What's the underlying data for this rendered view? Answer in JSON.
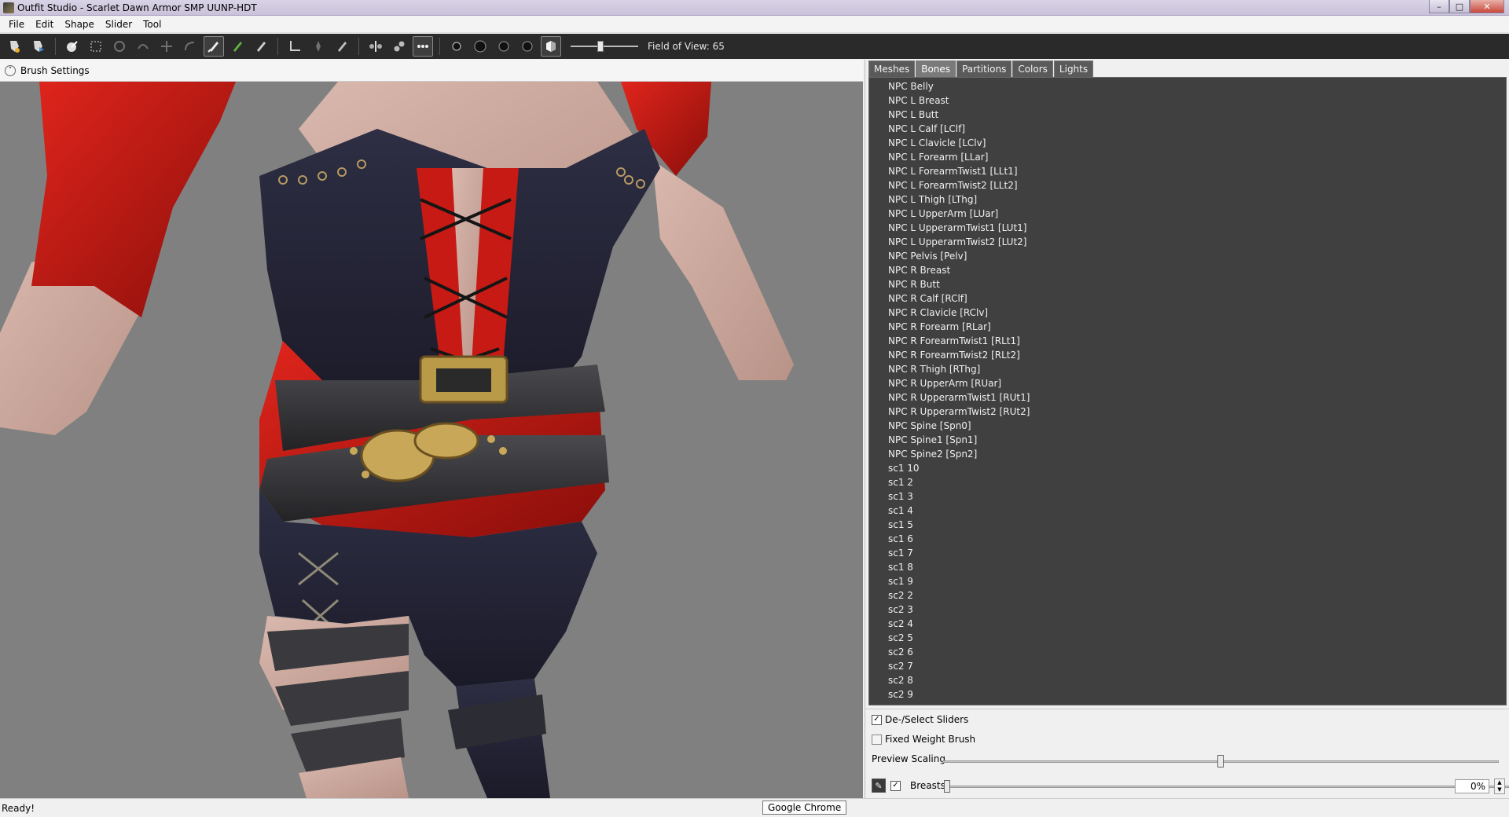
{
  "window": {
    "title": "Outfit Studio - Scarlet Dawn Armor SMP UUNP-HDT",
    "minimize": "–",
    "maximize": "□",
    "close": "✕"
  },
  "menu": [
    "File",
    "Edit",
    "Shape",
    "Slider",
    "Tool"
  ],
  "toolbar": {
    "field_of_view_label": "Field of View: 65",
    "field_of_view_value": 65
  },
  "brush_settings": {
    "toggle": "˅",
    "label": "Brush Settings"
  },
  "tabs": [
    "Meshes",
    "Bones",
    "Partitions",
    "Colors",
    "Lights"
  ],
  "active_tab": "Bones",
  "bones": [
    "NPC Belly",
    "NPC L Breast",
    "NPC L Butt",
    "NPC L Calf [LClf]",
    "NPC L Clavicle [LClv]",
    "NPC L Forearm [LLar]",
    "NPC L ForearmTwist1 [LLt1]",
    "NPC L ForearmTwist2 [LLt2]",
    "NPC L Thigh [LThg]",
    "NPC L UpperArm [LUar]",
    "NPC L UpperarmTwist1 [LUt1]",
    "NPC L UpperarmTwist2 [LUt2]",
    "NPC Pelvis [Pelv]",
    "NPC R Breast",
    "NPC R Butt",
    "NPC R Calf [RClf]",
    "NPC R Clavicle [RClv]",
    "NPC R Forearm [RLar]",
    "NPC R ForearmTwist1 [RLt1]",
    "NPC R ForearmTwist2 [RLt2]",
    "NPC R Thigh [RThg]",
    "NPC R UpperArm [RUar]",
    "NPC R UpperarmTwist1 [RUt1]",
    "NPC R UpperarmTwist2 [RUt2]",
    "NPC Spine [Spn0]",
    "NPC Spine1 [Spn1]",
    "NPC Spine2 [Spn2]",
    "sc1 10",
    "sc1 2",
    "sc1 3",
    "sc1 4",
    "sc1 5",
    "sc1 6",
    "sc1 7",
    "sc1 8",
    "sc1 9",
    "sc2 2",
    "sc2 3",
    "sc2 4",
    "sc2 5",
    "sc2 6",
    "sc2 7",
    "sc2 8",
    "sc2 9"
  ],
  "controls": {
    "deselect_sliders": {
      "label": "De-/Select Sliders",
      "checked": true,
      "mark": "✓"
    },
    "fixed_weight_brush": {
      "label": "Fixed Weight Brush",
      "checked": false,
      "mark": ""
    },
    "preview_scaling": {
      "label": "Preview Scaling",
      "value": 0.5
    },
    "breasts_slider": {
      "label": "Breasts",
      "checked": true,
      "mark": "✓",
      "value": "0%",
      "fraction": 0,
      "edit_icon": "✎",
      "spin_up": "▲",
      "spin_down": "▼"
    }
  },
  "status": "Ready!",
  "tooltip": "Google Chrome",
  "colors": {
    "toolbar_bg": "#2a2a2a",
    "viewport_bg": "#808080",
    "list_bg": "#404040"
  }
}
